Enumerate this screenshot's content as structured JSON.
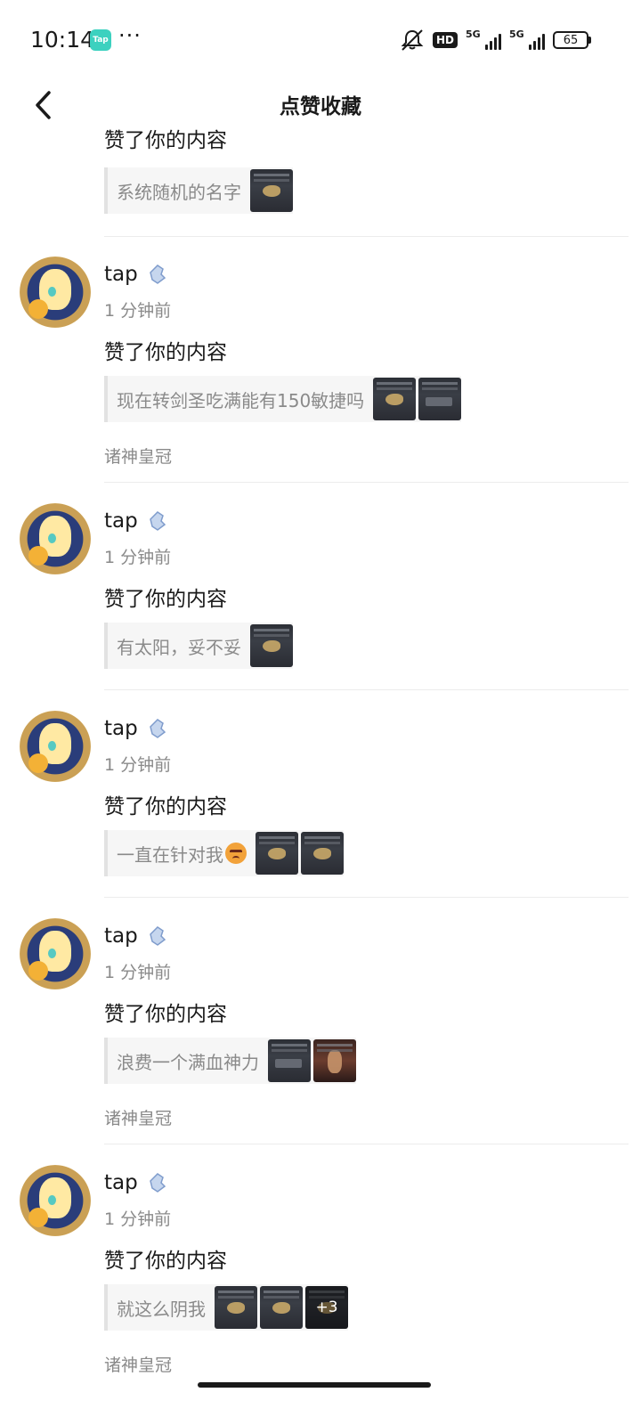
{
  "status_bar": {
    "time": "10:14",
    "app_icon_text": "Tap",
    "dots": "···",
    "hd_label": "HD",
    "network_1": "5G",
    "network_2": "5G",
    "battery": "65"
  },
  "header": {
    "title": "点赞收藏",
    "back_icon": "chevron-left-icon"
  },
  "partial_item": {
    "action": "赞了你的内容",
    "quote": "系统随机的名字"
  },
  "items": [
    {
      "user": "tap",
      "time": "1 分钟前",
      "action": "赞了你的内容",
      "quote": "现在转剑圣吃满能有150敏捷吗",
      "game": "诸神皇冠"
    },
    {
      "user": "tap",
      "time": "1 分钟前",
      "action": "赞了你的内容",
      "quote": "有太阳，妥不妥"
    },
    {
      "user": "tap",
      "time": "1 分钟前",
      "action": "赞了你的内容",
      "quote": "一直在针对我"
    },
    {
      "user": "tap",
      "time": "1 分钟前",
      "action": "赞了你的内容",
      "quote": "浪费一个满血神力",
      "game": "诸神皇冠"
    },
    {
      "user": "tap",
      "time": "1 分钟前",
      "action": "赞了你的内容",
      "quote": "就这么阴我",
      "more_images": "+3",
      "game": "诸神皇冠"
    }
  ]
}
